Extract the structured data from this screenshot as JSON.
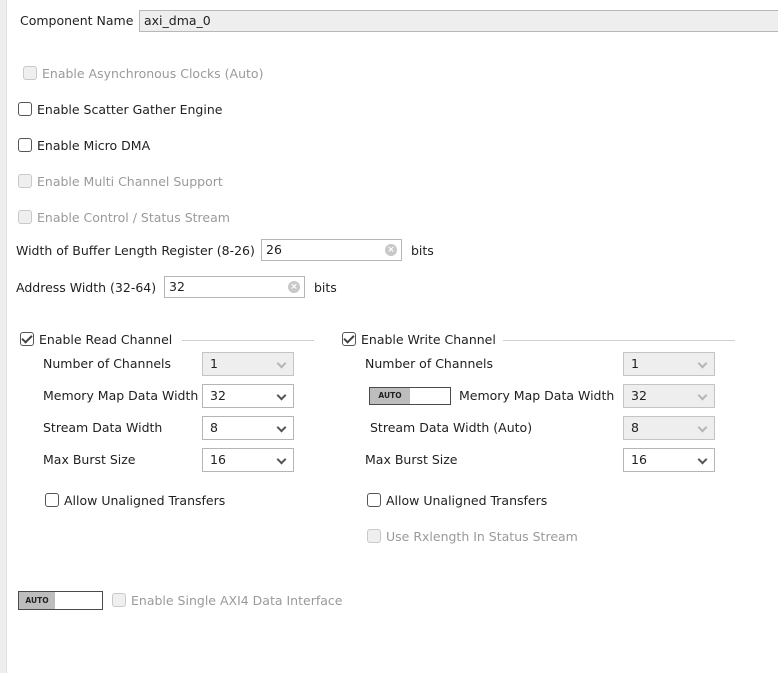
{
  "component_name": {
    "label": "Component Name",
    "value": "axi_dma_0"
  },
  "options": {
    "async_clocks": {
      "label": "Enable Asynchronous Clocks (Auto)",
      "checked": false,
      "enabled": false
    },
    "scatter_gather": {
      "label": "Enable Scatter Gather Engine",
      "checked": false,
      "enabled": true
    },
    "micro_dma": {
      "label": "Enable Micro DMA",
      "checked": false,
      "enabled": true
    },
    "multi_channel": {
      "label": "Enable Multi Channel Support",
      "checked": false,
      "enabled": false
    },
    "control_status": {
      "label": "Enable Control / Status Stream",
      "checked": false,
      "enabled": false
    }
  },
  "buffer_length": {
    "label": "Width of Buffer Length Register (8-26)",
    "value": "26",
    "unit": "bits"
  },
  "address_width": {
    "label": "Address Width (32-64)",
    "value": "32",
    "unit": "bits"
  },
  "read_channel": {
    "label": "Enable Read Channel",
    "checked": true,
    "num_channels": {
      "label": "Number of Channels",
      "value": "1",
      "enabled": false
    },
    "mm_data_width": {
      "label": "Memory Map Data Width",
      "value": "32",
      "enabled": true
    },
    "stream_data_width": {
      "label": "Stream Data Width",
      "value": "8",
      "enabled": true
    },
    "max_burst": {
      "label": "Max Burst Size",
      "value": "16",
      "enabled": true
    },
    "unaligned": {
      "label": "Allow Unaligned Transfers",
      "checked": false
    }
  },
  "write_channel": {
    "label": "Enable Write Channel",
    "checked": true,
    "num_channels": {
      "label": "Number of Channels",
      "value": "1",
      "enabled": false
    },
    "mm_auto_toggle": "AUTO",
    "mm_data_width": {
      "label": "Memory Map Data Width",
      "value": "32",
      "enabled": false
    },
    "stream_data_width": {
      "label": "Stream Data Width (Auto)",
      "value": "8",
      "enabled": false
    },
    "max_burst": {
      "label": "Max Burst Size",
      "value": "16",
      "enabled": true
    },
    "unaligned": {
      "label": "Allow Unaligned Transfers",
      "checked": false
    },
    "rxlength": {
      "label": "Use Rxlength In Status Stream",
      "checked": false,
      "enabled": false
    }
  },
  "single_axi4": {
    "auto_toggle": "AUTO",
    "label": "Enable Single AXI4 Data Interface",
    "checked": false,
    "enabled": false
  }
}
